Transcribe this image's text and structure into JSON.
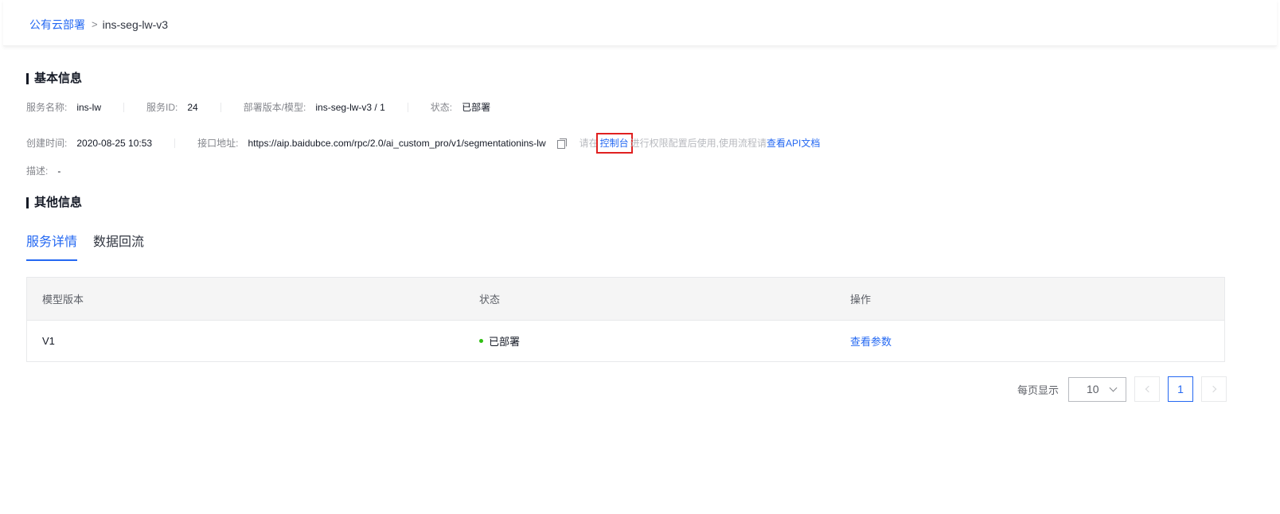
{
  "breadcrumb": {
    "parent": "公有云部署",
    "separator": ">",
    "current": "ins-seg-lw-v3"
  },
  "basic_info": {
    "title": "基本信息",
    "service_name": {
      "label": "服务名称:",
      "value": "ins-lw"
    },
    "service_id": {
      "label": "服务ID:",
      "value": "24"
    },
    "deploy_version": {
      "label": "部署版本/模型:",
      "value": "ins-seg-lw-v3 / 1"
    },
    "status": {
      "label": "状态:",
      "value": "已部署"
    },
    "created_time": {
      "label": "创建时间:",
      "value": "2020-08-25 10:53"
    },
    "api_url": {
      "label": "接口地址:",
      "value": "https://aip.baidubce.com/rpc/2.0/ai_custom_pro/v1/segmentationins-lw"
    },
    "hint": {
      "prefix": "请在",
      "console_link": "控制台",
      "middle": "进行权限配置后使用,使用流程请",
      "doc_link": "查看API文档"
    },
    "description": {
      "label": "描述:",
      "value": "-"
    }
  },
  "other_info": {
    "title": "其他信息"
  },
  "tabs": [
    {
      "label": "服务详情",
      "active": true
    },
    {
      "label": "数据回流",
      "active": false
    }
  ],
  "table": {
    "headers": [
      "模型版本",
      "状态",
      "操作"
    ],
    "rows": [
      {
        "version": "V1",
        "status": "已部署",
        "action": "查看参数"
      }
    ]
  },
  "pagination": {
    "page_size_label": "每页显示",
    "page_size": "10",
    "current_page": "1"
  },
  "colors": {
    "accent": "#2468f2",
    "success": "#30bf13",
    "highlight_box": "#e02020"
  }
}
